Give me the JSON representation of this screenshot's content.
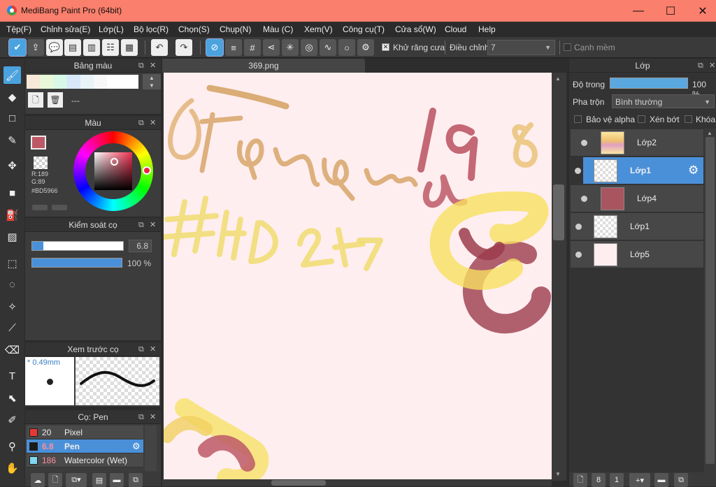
{
  "window": {
    "title": "MediBang Paint Pro (64bit)",
    "minimize": "—",
    "maximize": "☐",
    "close": "✕"
  },
  "menu": [
    "Tệp(F)",
    "Chỉnh sửa(E)",
    "Lớp(L)",
    "Bộ lọc(R)",
    "Chọn(S)",
    "Chụp(N)",
    "Màu (C)",
    "Xem(V)",
    "Công cụ(T)",
    "Cửa sổ(W)",
    "Cloud",
    "Help"
  ],
  "toolbar": {
    "antialias_label": "Khử răng cưa",
    "adjust_label": "Điều chỉnh",
    "adjust_value": "7",
    "soft_edge_label": "Cạnh mềm"
  },
  "palette_panel": {
    "title": "Bảng màu",
    "value": "---"
  },
  "color_panel": {
    "title": "Màu",
    "r": "R:189",
    "g": "G:89",
    "hex": "#BD5966",
    "color": "#bd5966"
  },
  "brush_control": {
    "title": "Kiểm soát cọ",
    "size": "6.8",
    "opacity": "100 %"
  },
  "brush_preview": {
    "title": "Xem trước cọ",
    "size": "* 0.49mm"
  },
  "brush_list": {
    "title": "Cọ: Pen",
    "items": [
      {
        "size": "20",
        "name": "Pixel",
        "color": "#e53935"
      },
      {
        "size": "6.8",
        "name": "Pen",
        "color": "#1a1a1a"
      },
      {
        "size": "186",
        "name": "Watercolor (Wet)",
        "color": "#7fd7f0"
      }
    ]
  },
  "document": {
    "tab": "369.png"
  },
  "layer_panel": {
    "title": "Lớp",
    "opacity_label": "Độ trong",
    "opacity_value": "100 %",
    "blend_label": "Pha trộn",
    "blend_value": "Bình thường",
    "protect_alpha": "Bảo vệ alpha",
    "clipping": "Xén bớt",
    "lock": "Khóa",
    "layers": [
      {
        "name": "Lớp2"
      },
      {
        "name": "Lớp1"
      },
      {
        "name": "Lớp4"
      },
      {
        "name": "Lớp1"
      },
      {
        "name": "Lớp5"
      }
    ]
  }
}
